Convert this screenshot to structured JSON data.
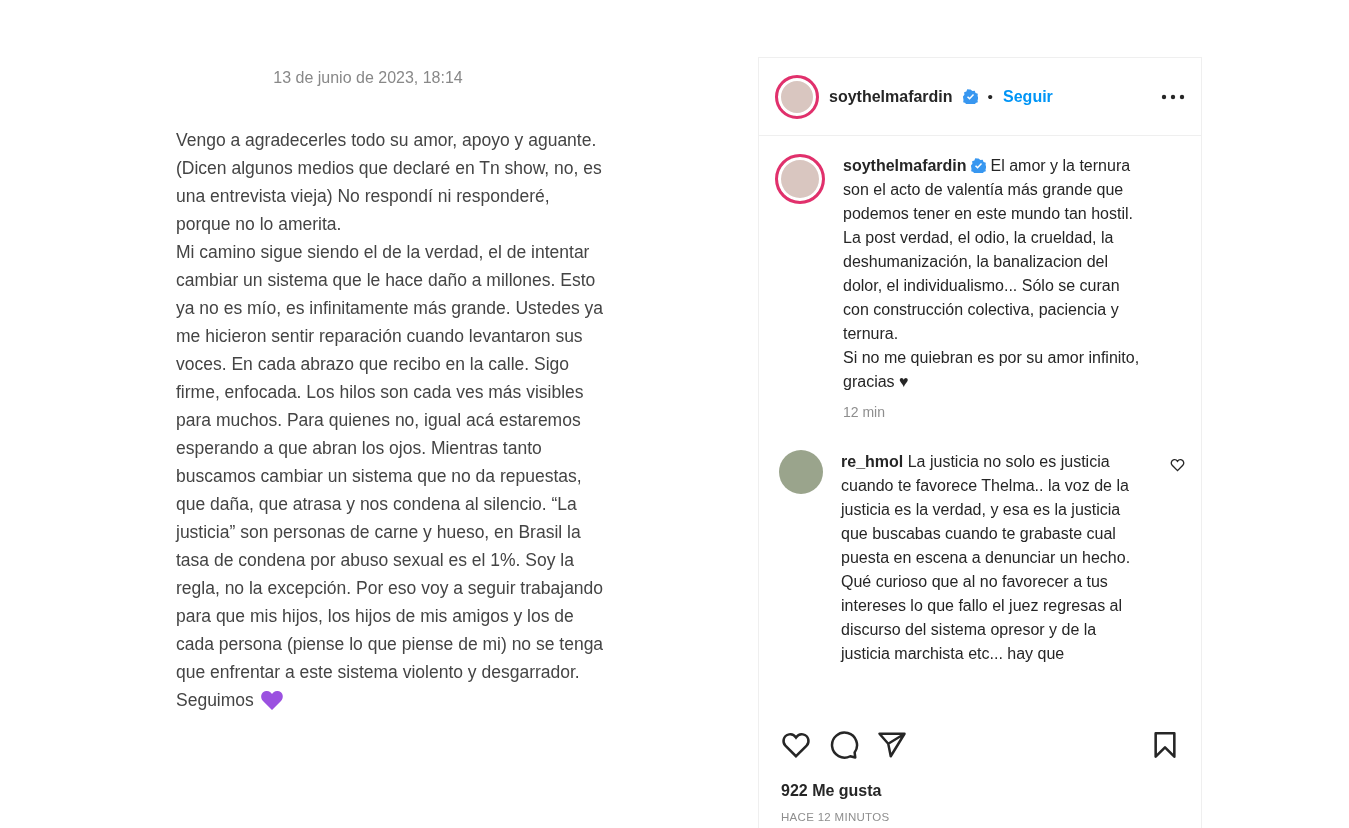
{
  "note": {
    "date": "13 de junio de 2023, 18:14",
    "paragraphs": [
      "Vengo a agradecerles todo su amor, apoyo y aguante.",
      "(Dicen algunos medios que declaré en Tn show, no, es una entrevista vieja) No respondí ni responderé, porque no lo amerita.",
      "Mi camino sigue siendo el de la verdad, el de intentar cambiar un sistema que le hace daño a millones. Esto ya no es mío, es infinitamente más grande. Ustedes ya me hicieron sentir reparación cuando levantaron sus voces. En cada abrazo que recibo en la calle. Sigo firme, enfocada. Los hilos son cada ves más visibles para muchos. Para quienes no, igual acá estaremos esperando a que abran los ojos. Mientras tanto buscamos cambiar un sistema que no da repuestas, que daña, que atrasa y nos condena al silencio. “La justicia” son personas de carne y hueso, en Brasil la tasa de condena por abuso sexual es el 1%. Soy la regla, no la excepción. Por eso voy a seguir trabajando para que mis hijos, los hijos de mis amigos y los de cada persona (piense lo que piense de mi) no se tenga que enfrentar a este sistema violento y desgarrador."
    ],
    "closing": "Seguimos"
  },
  "post": {
    "header": {
      "username": "soythelmafardin",
      "verified": true,
      "separator": "•",
      "follow": "Seguir"
    },
    "caption": {
      "username": "soythelmafardin",
      "verified": true,
      "text": "El amor y la ternura son el acto de valentía más grande que podemos tener en este mundo tan hostil. La post verdad, el odio, la crueldad, la deshumanización, la banalizacion del dolor, el individualismo... Sólo se curan con construcción colectiva, paciencia y ternura.\nSi no me quiebran es por su amor infinito, gracias ♥",
      "time": "12 min"
    },
    "comments": [
      {
        "username": "re_hmol",
        "text": "La justicia no solo es justicia cuando te favorece Thelma.. la voz de la justicia es la verdad, y esa es la justicia que buscabas cuando te grabaste cual puesta en escena a denunciar un hecho. Qué curioso que al no favorecer a tus intereses lo que fallo el juez regresas al discurso del sistema opresor y de la justicia marchista etc... hay que",
        "liked": false
      }
    ],
    "likes": "922 Me gusta",
    "posted": "HACE 12 MINUTOS"
  }
}
